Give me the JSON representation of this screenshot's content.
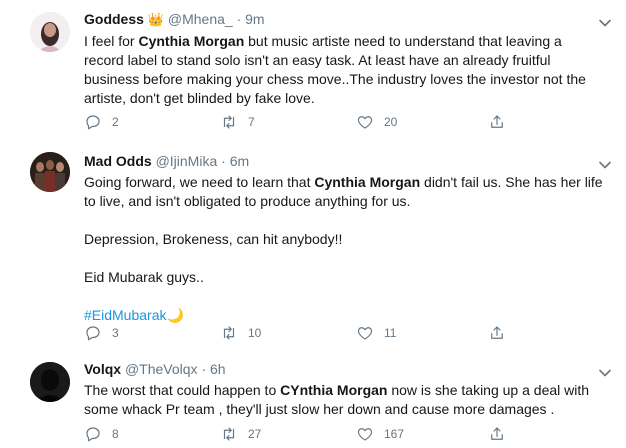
{
  "tweets": [
    {
      "name": "Goddess",
      "name_emoji": "👑",
      "handle": "@Mhena_",
      "time": "9m",
      "text_parts": [
        "I feel for ",
        "Cynthia Morgan",
        " but music artiste need to understand that leaving a record label to stand solo isn't an easy task. At least have an already fruitful business before making your chess move..The industry loves the investor not the artiste, don't get blinded by fake love."
      ],
      "replies": "2",
      "retweets": "7",
      "likes": "20"
    },
    {
      "name": "Mad Odds",
      "handle": "@IjinMika",
      "time": "6m",
      "text_parts": [
        "Going forward, we need to learn that ",
        "Cynthia Morgan",
        " didn't fail us. She has her life to live, and isn't obligated to produce anything for us."
      ],
      "line2": "Depression, Brokeness, can hit anybody!!",
      "line3": "Eid Mubarak guys..",
      "hashtag": "#EidMubarak",
      "hashtag_emoji": "🌙",
      "replies": "3",
      "retweets": "10",
      "likes": "11"
    },
    {
      "name": "Volqx",
      "handle": "@TheVolqx",
      "time": "6h",
      "text_parts": [
        "The worst that could happen to ",
        "CYnthia Morgan",
        " now is she taking up a deal with some whack Pr team , they'll just slow her down and cause more damages ."
      ],
      "replies": "8",
      "retweets": "27",
      "likes": "167"
    }
  ],
  "separator": "·"
}
